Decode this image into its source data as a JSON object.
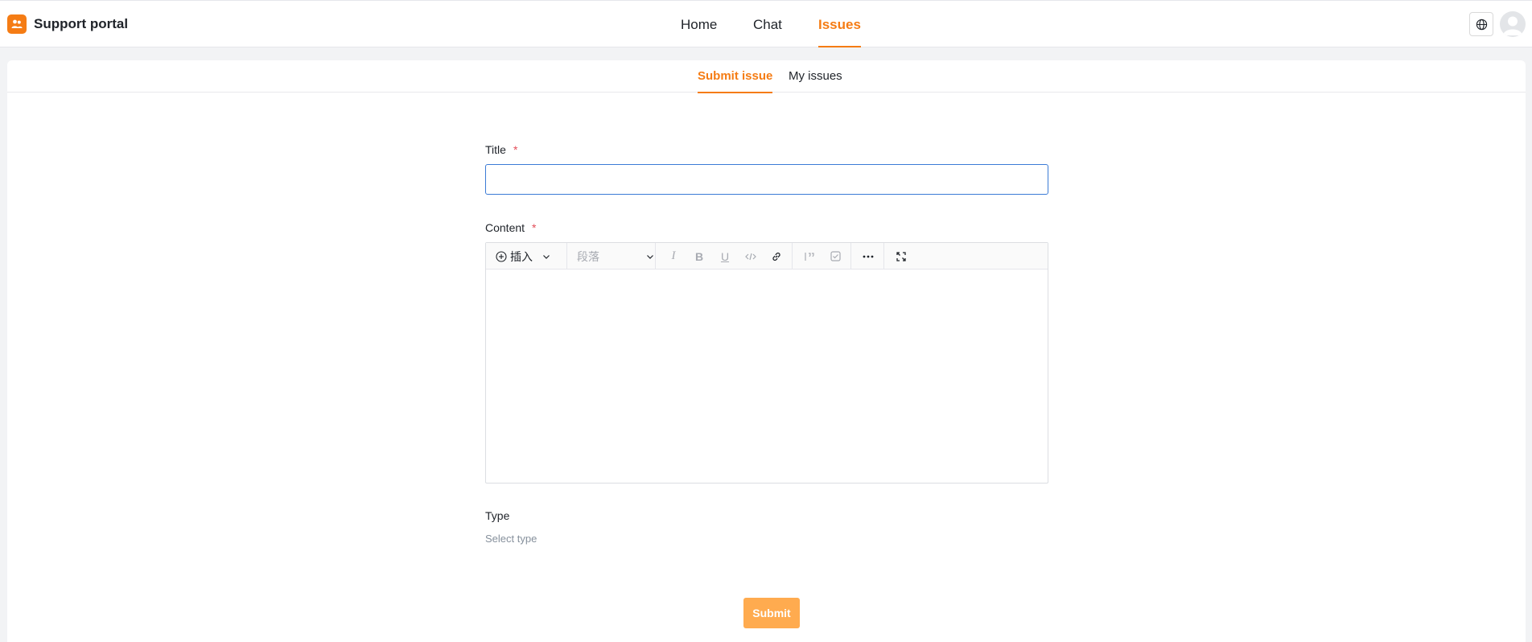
{
  "brand": {
    "name": "Support portal"
  },
  "nav": {
    "home": "Home",
    "chat": "Chat",
    "issues": "Issues"
  },
  "subtabs": {
    "submit": "Submit issue",
    "mine": "My issues"
  },
  "form": {
    "title_label": "Title",
    "content_label": "Content",
    "type_label": "Type",
    "required_mark": "*",
    "title_value": "",
    "type_placeholder": "Select type",
    "submit_label": "Submit"
  },
  "editor": {
    "insert_label": "插入",
    "paragraph_label": "段落",
    "italic": "I",
    "bold": "B",
    "underline": "U"
  },
  "colors": {
    "accent": "#f57c14",
    "submit_bg": "#ffab4f",
    "required": "#e34d59",
    "input_focus": "#3b7bd6"
  }
}
